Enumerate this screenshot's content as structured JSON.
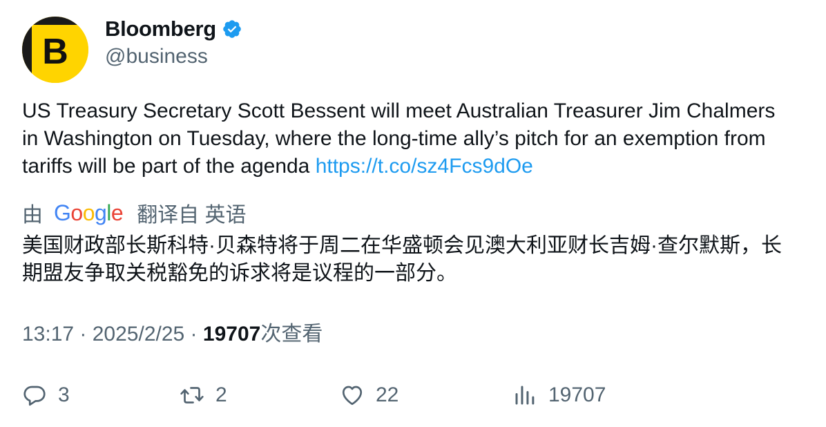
{
  "author": {
    "name": "Bloomberg",
    "handle": "@business",
    "avatar_letter": "B",
    "verified": true
  },
  "tweet": {
    "text": "US Treasury Secretary Scott Bessent will meet Australian Treasurer Jim Chalmers in Washington on Tuesday, where the long-time ally’s pitch for an exemption from tariffs will be part of the agenda ",
    "link": "https://t.co/sz4Fcs9dOe"
  },
  "translation": {
    "prefix": "由",
    "provider": "Google",
    "suffix": "翻译自 英语",
    "text": "美国财政部长斯科特·贝森特将于周二在华盛顿会见澳大利亚财长吉姆·查尔默斯，长期盟友争取关税豁免的诉求将是议程的一部分。"
  },
  "meta": {
    "time": "13:17",
    "separator": " · ",
    "date": "2025/2/25",
    "views_count": "19707",
    "views_label": "次查看"
  },
  "actions": {
    "replies": "3",
    "retweets": "2",
    "likes": "22",
    "views": "19707"
  },
  "colors": {
    "text_primary": "#0f1419",
    "text_secondary": "#536471",
    "link": "#1d9bf0",
    "verified": "#1d9bf0",
    "avatar_bg": "#ffd400"
  },
  "icons": {
    "reply": "reply-icon",
    "retweet": "retweet-icon",
    "like": "heart-icon",
    "views": "analytics-icon",
    "verified": "verified-badge-icon"
  }
}
